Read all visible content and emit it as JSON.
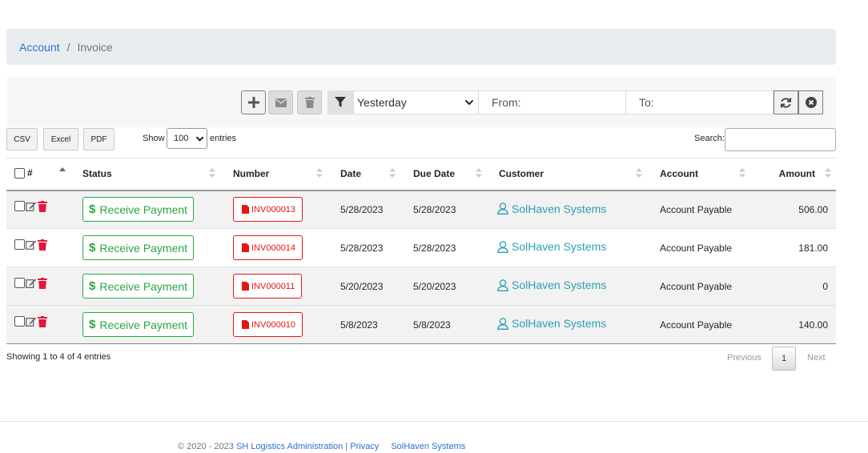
{
  "breadcrumb": {
    "parent": "Account",
    "separator": "/",
    "current": "Invoice"
  },
  "toolbar": {
    "period": "Yesterday",
    "from_placeholder": "From:",
    "to_placeholder": "To:"
  },
  "export_buttons": {
    "csv": "CSV",
    "excel": "Excel",
    "pdf": "PDF"
  },
  "length": {
    "show": "Show",
    "value": "100",
    "entries": "entries"
  },
  "search": {
    "label": "Search:",
    "value": ""
  },
  "table": {
    "columns": {
      "index": "#",
      "status": "Status",
      "number": "Number",
      "date": "Date",
      "due_date": "Due Date",
      "customer": "Customer",
      "account": "Account",
      "amount": "Amount"
    },
    "rows": [
      {
        "status": "Receive Payment",
        "number": "INV000013",
        "date": "5/28/2023",
        "due_date": "5/28/2023",
        "customer": "SolHaven Systems",
        "account": "Account Payable",
        "amount": "506.00"
      },
      {
        "status": "Receive Payment",
        "number": "INV000014",
        "date": "5/28/2023",
        "due_date": "5/28/2023",
        "customer": "SolHaven Systems",
        "account": "Account Payable",
        "amount": "181.00"
      },
      {
        "status": "Receive Payment",
        "number": "INV000011",
        "date": "5/20/2023",
        "due_date": "5/20/2023",
        "customer": "SolHaven Systems",
        "account": "Account Payable",
        "amount": "0"
      },
      {
        "status": "Receive Payment",
        "number": "INV000010",
        "date": "5/8/2023",
        "due_date": "5/8/2023",
        "customer": "SolHaven Systems",
        "account": "Account Payable",
        "amount": "140.00"
      }
    ]
  },
  "pagination": {
    "info": "Showing 1 to 4 of 4 entries",
    "previous": "Previous",
    "current": "1",
    "next": "Next"
  },
  "footer": {
    "copyright": "© 2020 - 2023",
    "company": "SH Logistics Administration",
    "separator": "|",
    "privacy": "Privacy",
    "brand": "SolHaven Systems"
  },
  "colors": {
    "success": "#28a745",
    "danger": "#e81414",
    "link": "#2f6fd1",
    "customer_link": "#2a9fb4",
    "breadcrumb_bg": "#e9ecef"
  }
}
